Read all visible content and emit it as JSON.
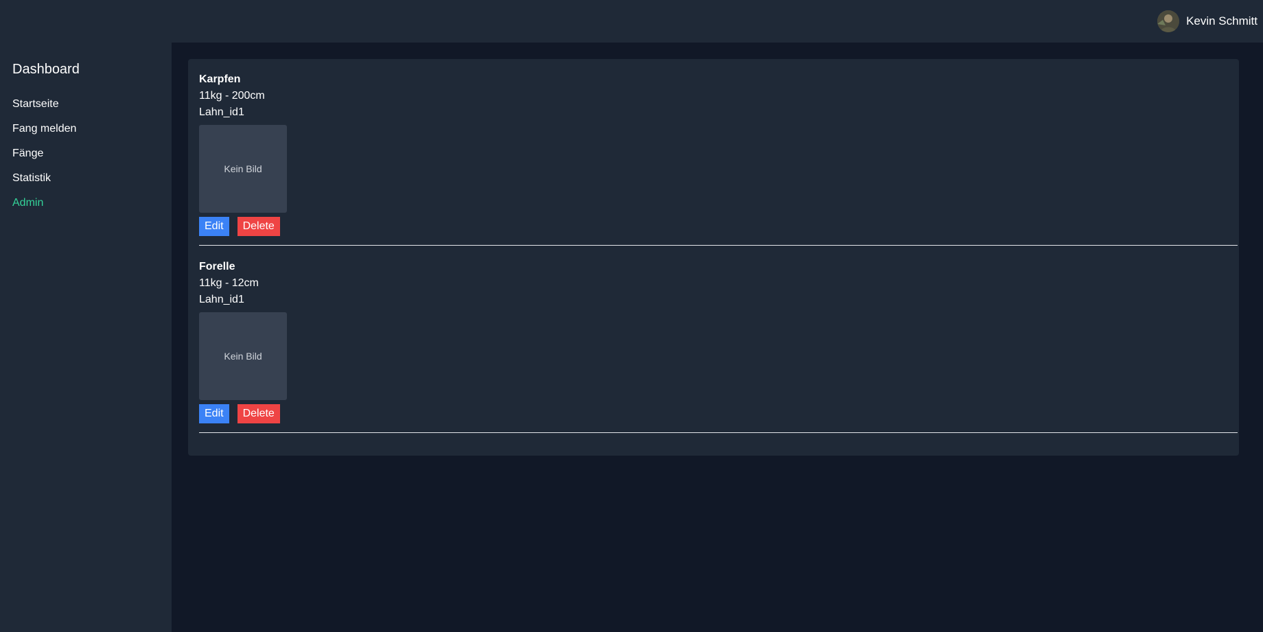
{
  "header": {
    "user_name": "Kevin Schmitt",
    "avatar_icon": "avatar-photo"
  },
  "sidebar": {
    "title": "Dashboard",
    "items": [
      {
        "label": "Startseite"
      },
      {
        "label": "Fang melden"
      },
      {
        "label": "Fänge"
      },
      {
        "label": "Statistik"
      },
      {
        "label": "Admin",
        "active": true
      }
    ]
  },
  "catches": [
    {
      "fish": "Karpfen",
      "measure": "11kg - 200cm",
      "water": "Lahn_id1",
      "image_placeholder": "Kein Bild",
      "edit_label": "Edit",
      "delete_label": "Delete"
    },
    {
      "fish": "Forelle",
      "measure": "11kg - 12cm",
      "water": "Lahn_id1",
      "image_placeholder": "Kein Bild",
      "edit_label": "Edit",
      "delete_label": "Delete"
    }
  ],
  "colors": {
    "background": "#111827",
    "panel": "#1f2937",
    "accent_active": "#34d399",
    "edit_button": "#3b82f6",
    "delete_button": "#ef4444"
  }
}
